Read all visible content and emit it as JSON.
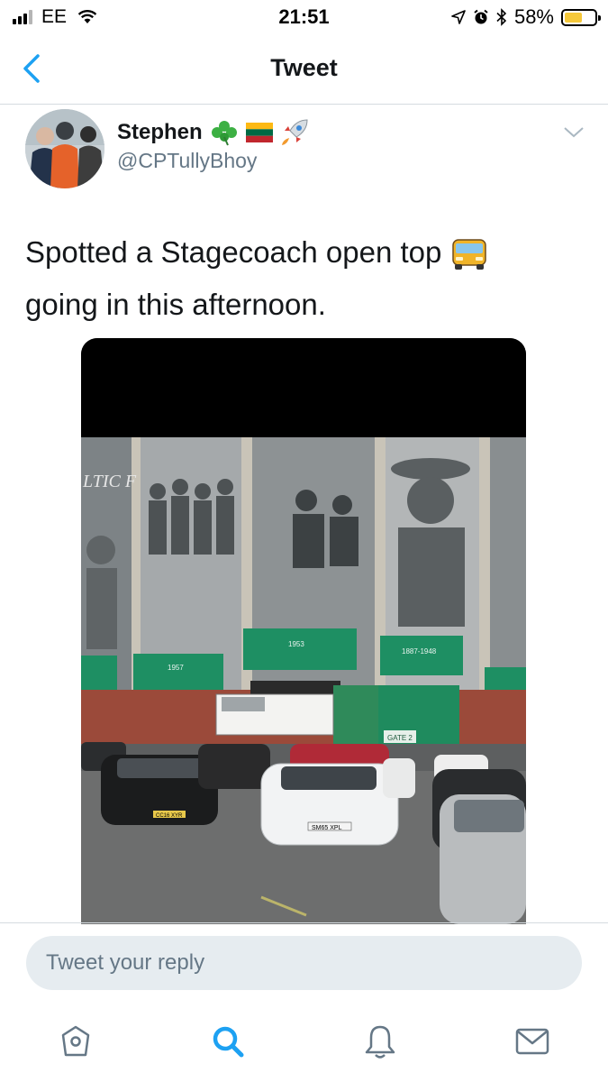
{
  "status_bar": {
    "carrier": "EE",
    "time": "21:51",
    "battery_percent": "58%",
    "battery_level": 0.58,
    "battery_color": "#f5c83a",
    "icons": [
      "signal-icon",
      "wifi-icon",
      "location-icon",
      "alarm-icon",
      "bluetooth-icon",
      "battery-icon"
    ]
  },
  "nav": {
    "title": "Tweet",
    "back_icon": "chevron-left-icon"
  },
  "tweet": {
    "author_name": "Stephen",
    "author_emojis": [
      "shamrock-icon",
      "lithuania-flag-icon",
      "rocket-icon"
    ],
    "handle": "@CPTullyBhoy",
    "text_line1": "Spotted a Stagecoach open top",
    "text_line2": "going in this afternoon.",
    "inline_emoji": "bus-icon",
    "media_caption_letters": "LTIC F",
    "media_banner_texts": [
      "1953",
      "1957",
      "1887-1948",
      "GATE 2",
      "SM65 XPL",
      "CC16 XYR"
    ]
  },
  "reply": {
    "placeholder": "Tweet your reply"
  },
  "tab_bar": {
    "items": [
      "home-icon",
      "search-icon",
      "notifications-icon",
      "messages-icon"
    ],
    "active": "search-icon"
  },
  "colors": {
    "accent": "#1da1f2",
    "handle": "#657786",
    "divider": "#d5dbe0",
    "reply_bg": "#e6ecf0",
    "banner_green": "#1e8f63"
  }
}
